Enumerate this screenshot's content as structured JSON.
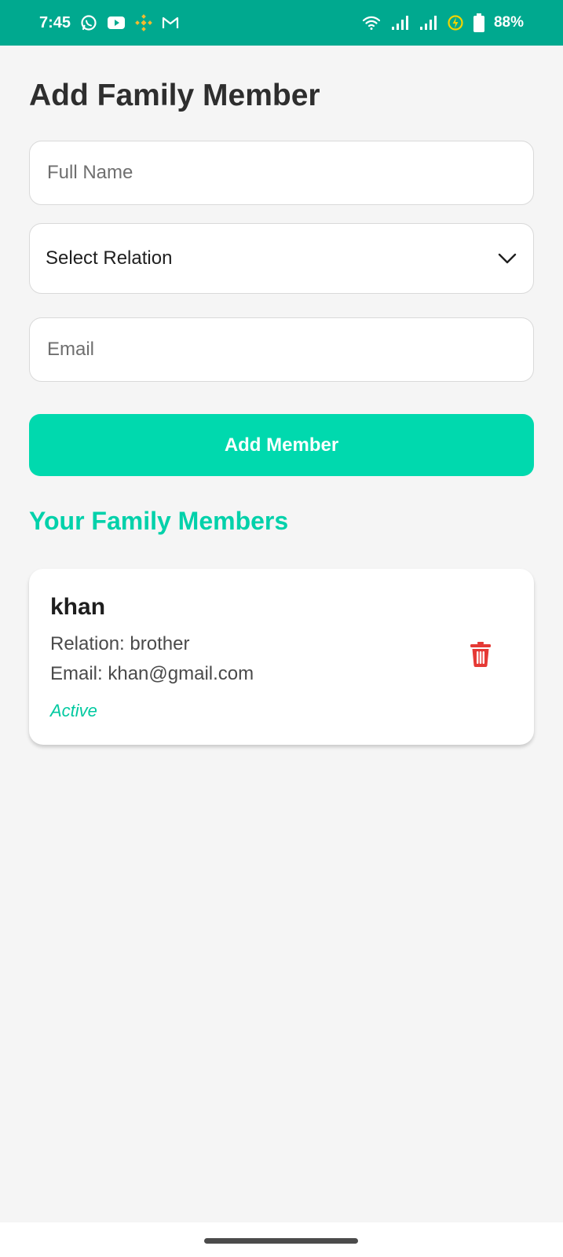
{
  "status_bar": {
    "time": "7:45",
    "battery_percent": "88%",
    "left_icons": [
      "whatsapp-icon",
      "youtube-icon",
      "binance-icon",
      "gmail-icon"
    ],
    "right_icons": [
      "wifi-icon",
      "signal-icon",
      "signal-icon",
      "charging-icon",
      "battery-icon"
    ],
    "background_color": "#00a98f"
  },
  "page": {
    "title": "Add Family Member"
  },
  "form": {
    "full_name": {
      "placeholder": "Full Name",
      "value": ""
    },
    "relation": {
      "selected": "Select Relation"
    },
    "email": {
      "placeholder": "Email",
      "value": ""
    },
    "submit_label": "Add Member",
    "accent_color": "#00d9ae"
  },
  "members_section": {
    "title": "Your Family Members",
    "members": [
      {
        "name": "khan",
        "relation_text": "Relation: brother",
        "email_text": "Email: khan@gmail.com",
        "status": "Active",
        "delete_icon": "trash-icon",
        "delete_color": "#e53935"
      }
    ]
  }
}
